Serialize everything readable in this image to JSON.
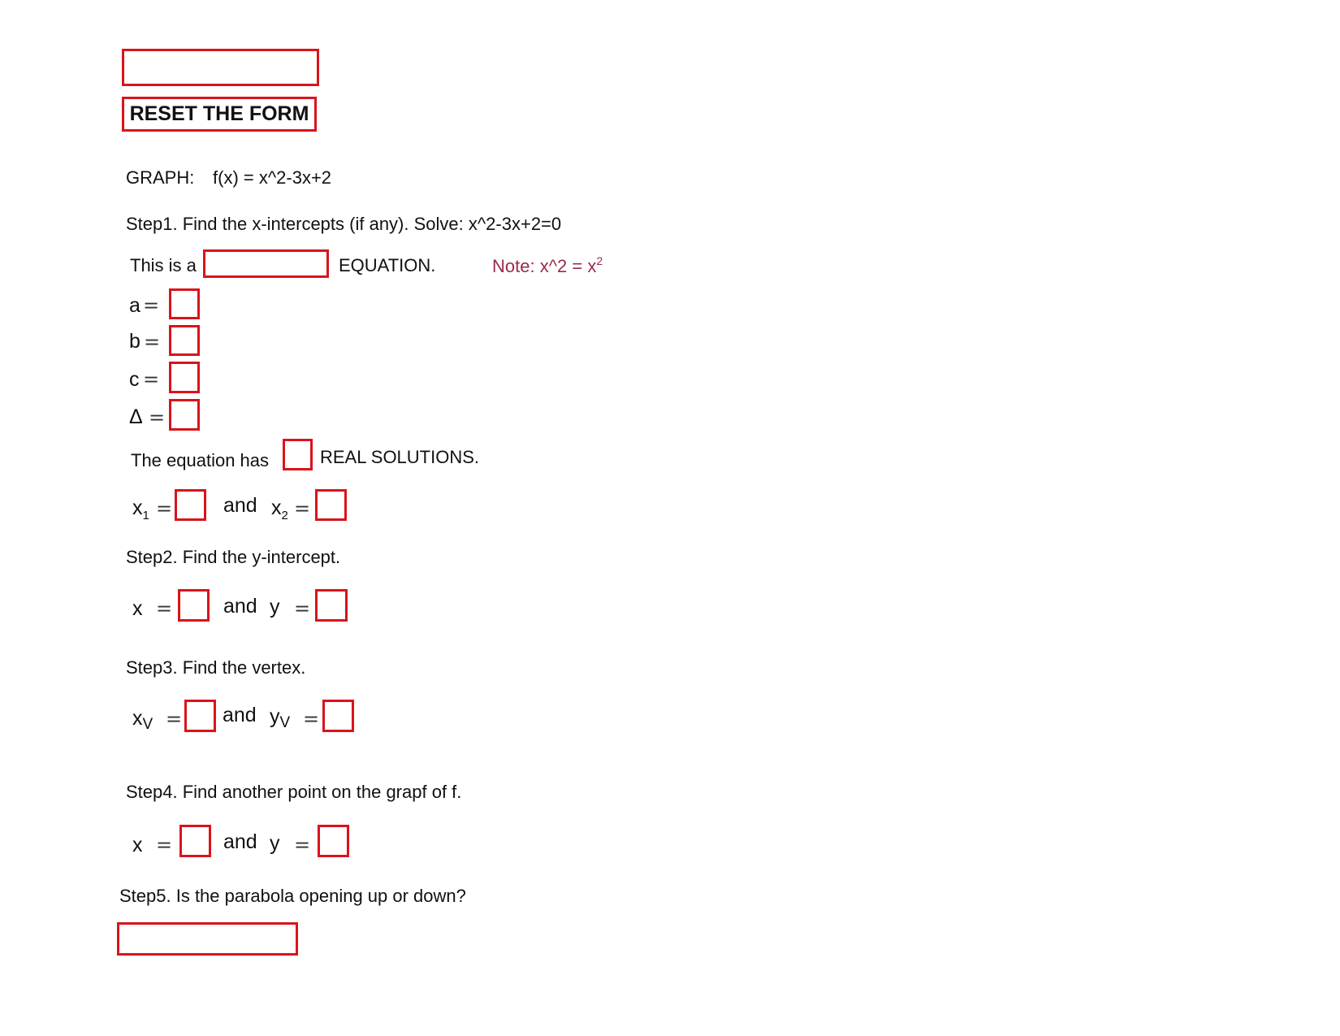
{
  "form": {
    "top_field_value": "",
    "reset_label": "RESET THE FORM"
  },
  "header": {
    "graph_label": "GRAPH:",
    "function": "f(x) = x^2-3x+2"
  },
  "step1": {
    "title": "Step1. Find the x-intercepts (if any). Solve: x^2-3x+2=0",
    "this_is_a": "This is a",
    "equation_type_value": "",
    "equation_label": "EQUATION.",
    "note_prefix": "Note: x^2 = x",
    "note_sup": "2",
    "coefficients": [
      {
        "label": "a",
        "value": ""
      },
      {
        "label": "b",
        "value": ""
      },
      {
        "label": "c",
        "value": ""
      },
      {
        "label": "Δ",
        "value": ""
      }
    ],
    "has_label": "The equation has",
    "solutions_count_value": "",
    "real_solutions_label": "REAL SOLUTIONS.",
    "x1_label": "x",
    "x1_sub": "1",
    "x2_label": "x",
    "x2_sub": "2",
    "and": "and",
    "x1_value": "",
    "x2_value": ""
  },
  "step2": {
    "title": "Step2. Find the y-intercept.",
    "x_label": "x",
    "y_label": "y",
    "and": "and",
    "x_value": "",
    "y_value": ""
  },
  "step3": {
    "title": "Step3. Find the vertex.",
    "x_label": "x",
    "x_sub": "V",
    "y_label": "y",
    "y_sub": "V",
    "and": "and",
    "xv_value": "",
    "yv_value": ""
  },
  "step4": {
    "title": "Step4. Find another point on the grapf of f.",
    "x_label": "x",
    "y_label": "y",
    "and": "and",
    "x_value": "",
    "y_value": ""
  },
  "step5": {
    "title": "Step5. Is the parabola opening up or down?",
    "answer_value": ""
  },
  "symbols": {
    "equals": "="
  },
  "colors": {
    "field_border": "#d9141b",
    "note": "#9b2b48"
  }
}
